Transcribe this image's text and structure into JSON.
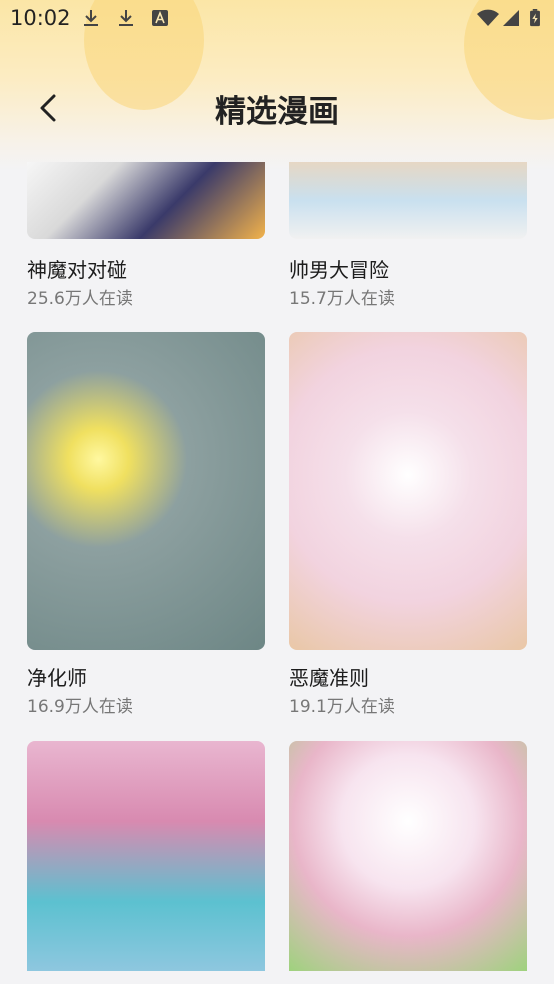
{
  "status_bar": {
    "time": "10:02",
    "icons": [
      "download-icon",
      "download-icon",
      "text-a-icon",
      "wifi-icon",
      "signal-icon",
      "battery-charging-icon"
    ]
  },
  "header": {
    "title": "精选漫画",
    "back_icon": "chevron-left-icon"
  },
  "comics": [
    {
      "name": "神魔对对碰",
      "reads": "25.6万人在读"
    },
    {
      "name": "帅男大冒险",
      "reads": "15.7万人在读"
    },
    {
      "name": "净化师",
      "reads": "16.9万人在读"
    },
    {
      "name": "恶魔准则",
      "reads": "19.1万人在读"
    },
    {
      "name": "",
      "reads": ""
    },
    {
      "name": "",
      "reads": ""
    }
  ],
  "colors": {
    "header_gradient_top": "#fbe6a6",
    "background": "#f3f3f5",
    "secondary_text": "#777777"
  }
}
